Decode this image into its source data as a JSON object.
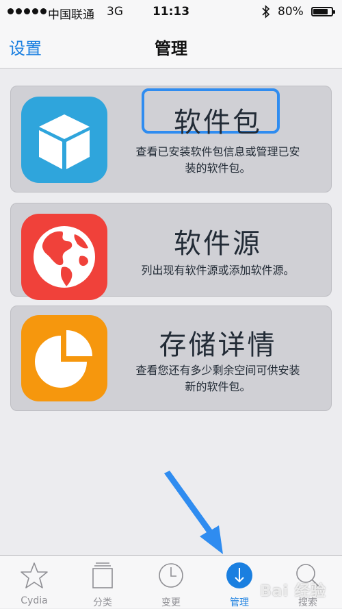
{
  "status_bar": {
    "carrier": "中国联通",
    "network": "3G",
    "time": "11:13",
    "battery_percent_text": "80%",
    "battery_level": 0.8
  },
  "nav": {
    "back_label": "设置",
    "title": "管理"
  },
  "cards": [
    {
      "title": "软件包",
      "desc_line1": "查看已安装软件包信息或管理已安",
      "desc_line2": "装的软件包。",
      "icon": "package-box-icon",
      "color": "#2fa5dc"
    },
    {
      "title": "软件源",
      "desc_line1": "列出现有软件源或添加软件源。",
      "icon": "globe-icon",
      "color": "#f0413a"
    },
    {
      "title": "存储详情",
      "desc_line1": "查看您还有多少剩余空间可供安装",
      "desc_line2": "新的软件包。",
      "icon": "pie-chart-icon",
      "color": "#f6970d"
    }
  ],
  "tabs": [
    {
      "label": "Cydia",
      "icon": "star-icon",
      "active": false
    },
    {
      "label": "分类",
      "icon": "sections-icon",
      "active": false
    },
    {
      "label": "变更",
      "icon": "clock-icon",
      "active": false
    },
    {
      "label": "管理",
      "icon": "download-icon",
      "active": true
    },
    {
      "label": "搜索",
      "icon": "search-icon",
      "active": false
    }
  ],
  "watermark": "Bai 经验",
  "colors": {
    "accent": "#1a7fe0",
    "highlight": "#2f8cf0",
    "arrow": "#2f8cf0"
  }
}
